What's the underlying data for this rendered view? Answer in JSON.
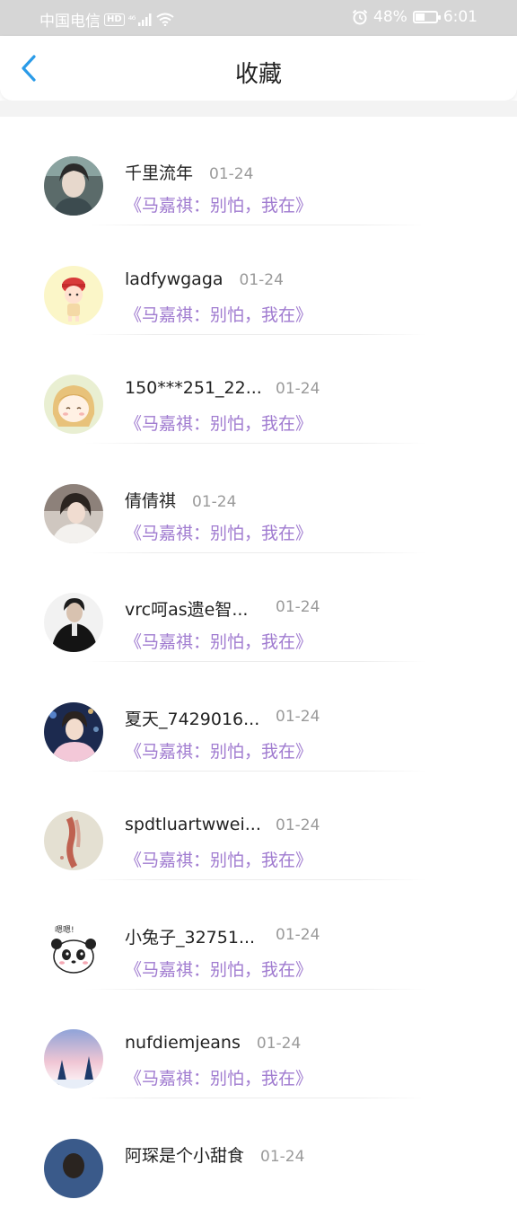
{
  "status_bar": {
    "carrier": "中国电信",
    "hd": "HD",
    "network": "⁴⁶",
    "battery_percent": "48%",
    "battery_level": 0.48,
    "time": "6:01"
  },
  "header": {
    "title": "收藏"
  },
  "colors": {
    "accent": "#2a9be8",
    "message": "#a07bd0",
    "date": "#9a9a9a"
  },
  "favorites": [
    {
      "name": "千里流年",
      "date": "01-24",
      "message": "《马嘉祺：别怕，我在》"
    },
    {
      "name": "ladfywgaga",
      "date": "01-24",
      "message": "《马嘉祺：别怕，我在》"
    },
    {
      "name": "150***251_22...",
      "date": "01-24",
      "message": "《马嘉祺：别怕，我在》"
    },
    {
      "name": "倩倩祺",
      "date": "01-24",
      "message": "《马嘉祺：别怕，我在》"
    },
    {
      "name": "vrc呵as遗e智...",
      "date": "01-24",
      "message": "《马嘉祺：别怕，我在》"
    },
    {
      "name": "夏天_7429016...",
      "date": "01-24",
      "message": "《马嘉祺：别怕，我在》"
    },
    {
      "name": "spdtluartwwei...",
      "date": "01-24",
      "message": "《马嘉祺：别怕，我在》"
    },
    {
      "name": "小兔子_32751...",
      "date": "01-24",
      "message": "《马嘉祺：别怕，我在》"
    },
    {
      "name": "nufdiemjeans",
      "date": "01-24",
      "message": "《马嘉祺：别怕，我在》"
    },
    {
      "name": "阿琛是个小甜食",
      "date": "01-24",
      "message": ""
    }
  ]
}
